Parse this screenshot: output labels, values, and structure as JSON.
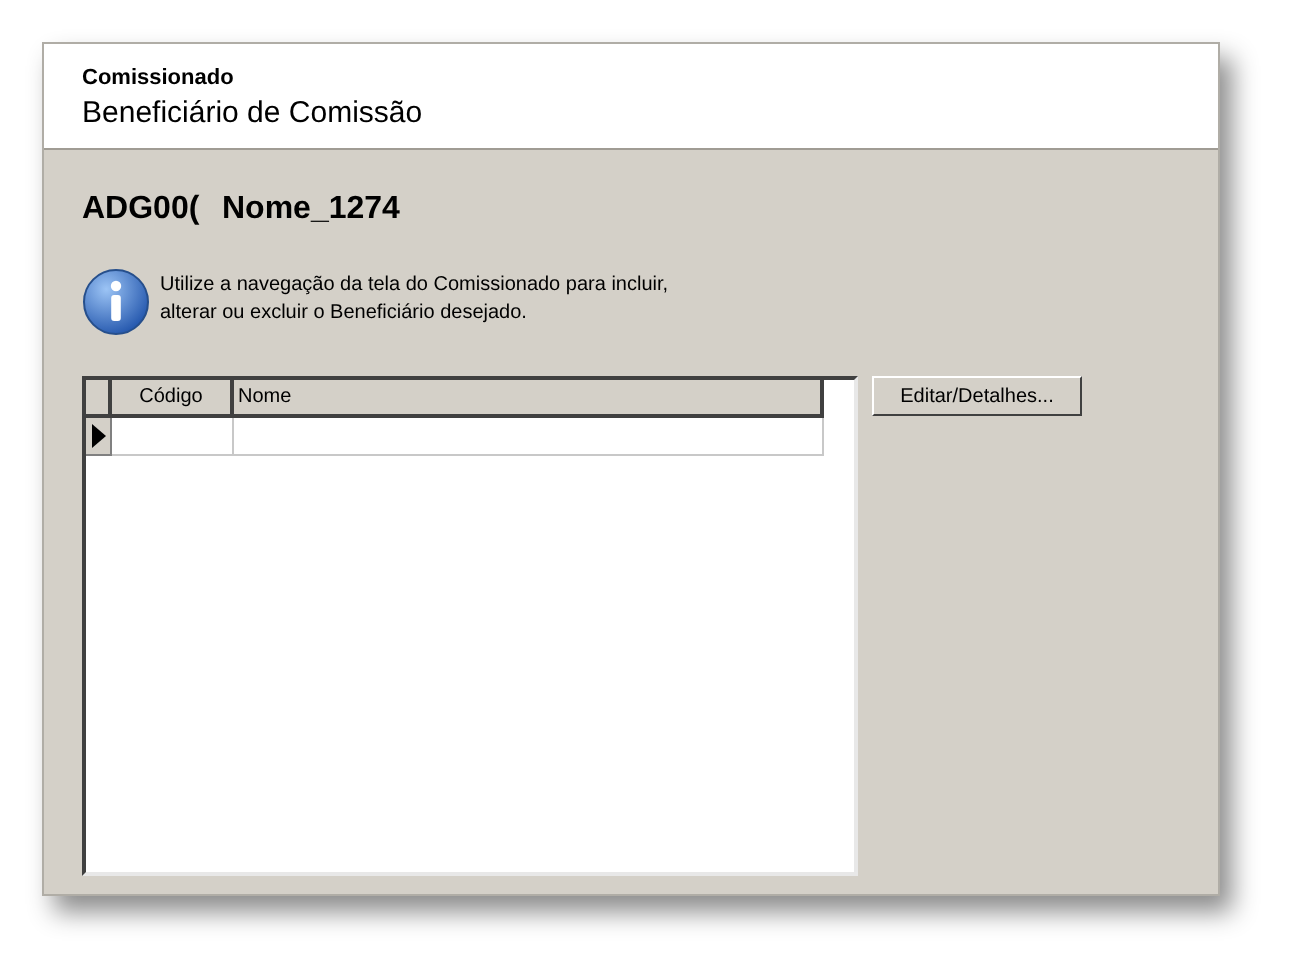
{
  "header": {
    "subtitle": "Comissionado",
    "title": "Beneficiário de Comissão"
  },
  "record": {
    "code": "ADG00(",
    "name": "Nome_1274"
  },
  "info": {
    "lines": [
      "Utilize a navegação da tela do Comissionado para incluir,",
      "alterar ou excluir o Beneficiário desejado."
    ]
  },
  "table": {
    "columns": [
      "Código",
      "Nome"
    ],
    "rows": [
      {
        "current": true
      }
    ]
  },
  "buttons": [
    "Editar/Detalhes..."
  ]
}
